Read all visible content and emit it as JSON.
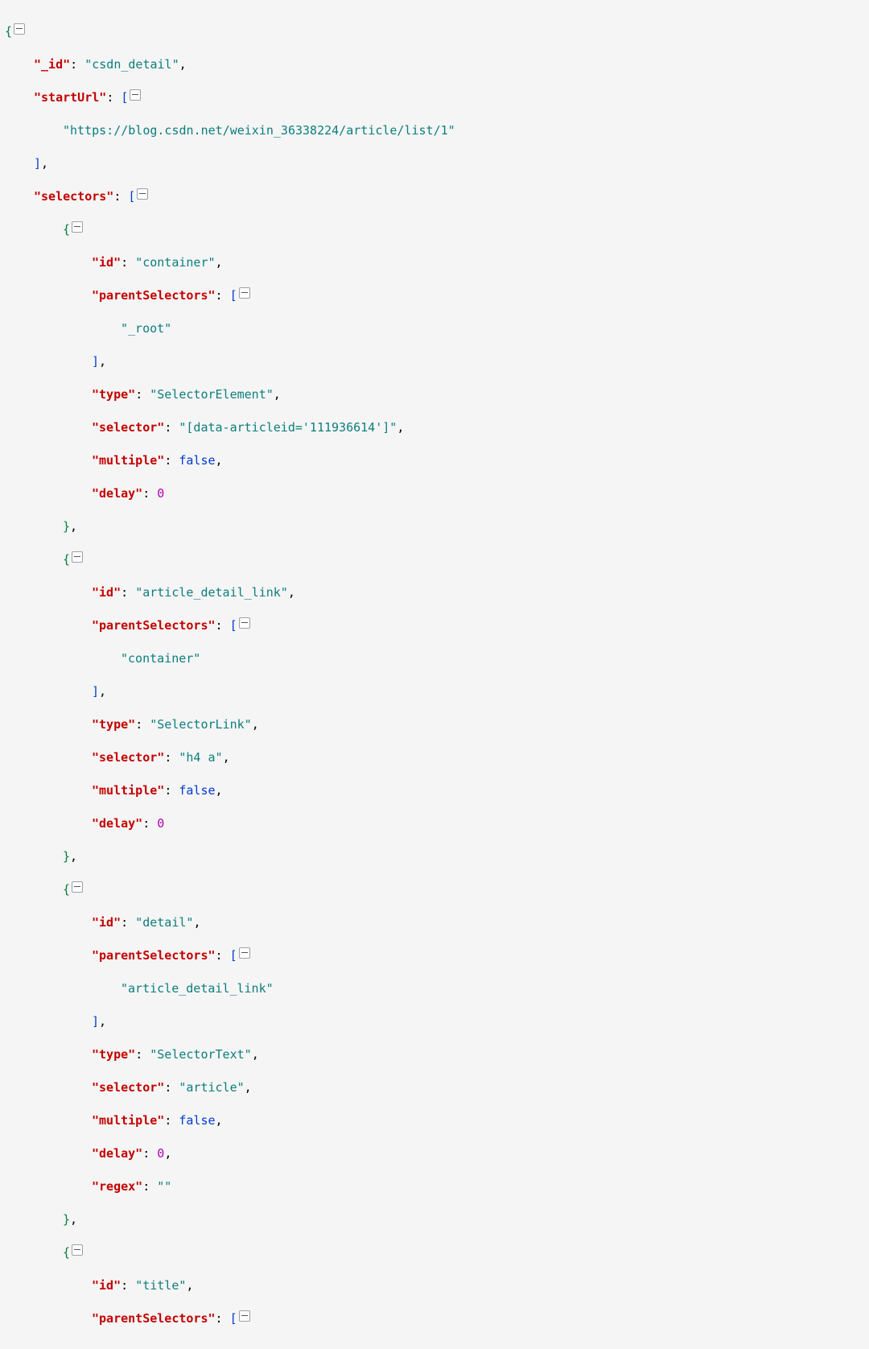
{
  "json": {
    "_id": "csdn_detail",
    "startUrl": [
      "https://blog.csdn.net/weixin_36338224/article/list/1"
    ],
    "selectors": [
      {
        "id": "container",
        "parentSelectors": [
          "_root"
        ],
        "type": "SelectorElement",
        "selector": "[data-articleid='111936614']",
        "multiple": false,
        "delay": 0
      },
      {
        "id": "article_detail_link",
        "parentSelectors": [
          "container"
        ],
        "type": "SelectorLink",
        "selector": "h4 a",
        "multiple": false,
        "delay": 0
      },
      {
        "id": "detail",
        "parentSelectors": [
          "article_detail_link"
        ],
        "type": "SelectorText",
        "selector": "article",
        "multiple": false,
        "delay": 0,
        "regex": ""
      },
      {
        "id": "title",
        "parentSelectors_partial": true
      }
    ]
  },
  "labels": {
    "k_id": "\"_id\"",
    "k_startUrl": "\"startUrl\"",
    "k_selectors": "\"selectors\"",
    "k_sel_id": "\"id\"",
    "k_parentSelectors": "\"parentSelectors\"",
    "k_type": "\"type\"",
    "k_selector": "\"selector\"",
    "k_multiple": "\"multiple\"",
    "k_delay": "\"delay\"",
    "k_regex": "\"regex\"",
    "v_id": "\"csdn_detail\"",
    "v_start0": "\"https://blog.csdn.net/weixin_36338224/article/list/1\"",
    "s0_id": "\"container\"",
    "s0_ps0": "\"_root\"",
    "s0_type": "\"SelectorElement\"",
    "s0_selector": "\"[data-articleid='111936614']\"",
    "s0_multiple": "false",
    "s0_delay": "0",
    "s1_id": "\"article_detail_link\"",
    "s1_ps0": "\"container\"",
    "s1_type": "\"SelectorLink\"",
    "s1_selector": "\"h4 a\"",
    "s1_multiple": "false",
    "s1_delay": "0",
    "s2_id": "\"detail\"",
    "s2_ps0": "\"article_detail_link\"",
    "s2_type": "\"SelectorText\"",
    "s2_selector": "\"article\"",
    "s2_multiple": "false",
    "s2_delay": "0",
    "s2_regex": "\"\"",
    "s3_id": "\"title\""
  }
}
